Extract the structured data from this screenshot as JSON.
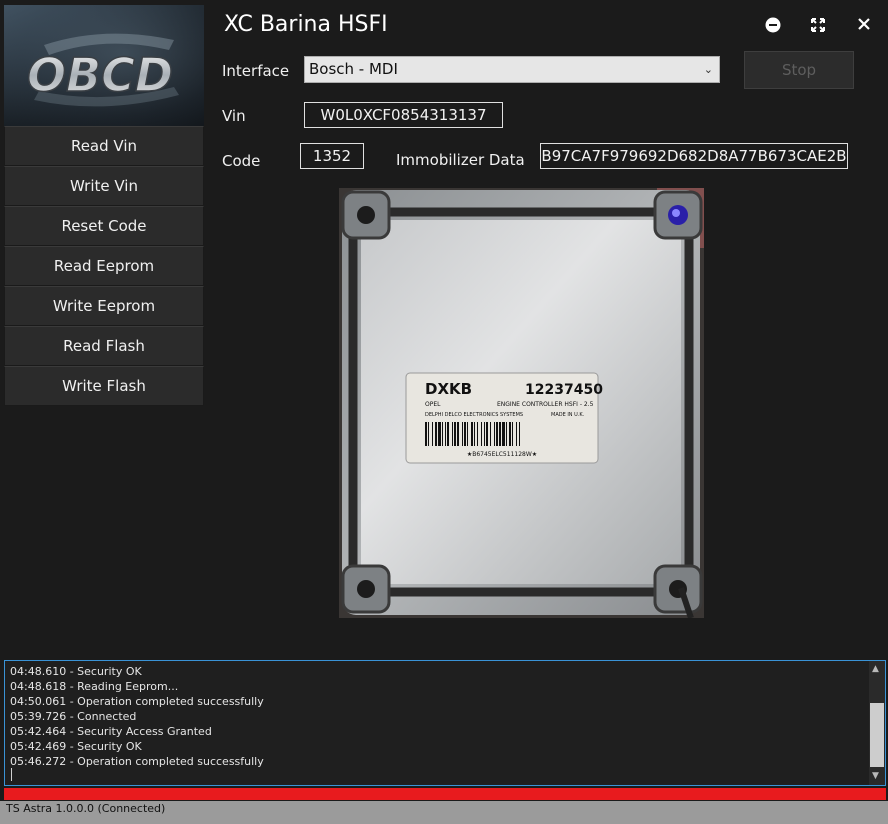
{
  "window": {
    "title": "XC Barina HSFI",
    "controls": {
      "minimize": "minimize",
      "maximize": "maximize",
      "close": "close"
    }
  },
  "logo": {
    "text": "OBCD"
  },
  "sidebar": {
    "items": [
      {
        "label": "Read Vin"
      },
      {
        "label": "Write Vin"
      },
      {
        "label": "Reset Code"
      },
      {
        "label": "Read Eeprom"
      },
      {
        "label": "Write Eeprom"
      },
      {
        "label": "Read Flash"
      },
      {
        "label": "Write Flash"
      }
    ]
  },
  "form": {
    "interface_label": "Interface",
    "interface_value": "Bosch - MDI",
    "stop_label": "Stop",
    "vin_label": "Vin",
    "vin_value": "W0L0XCF0854313137",
    "code_label": "Code",
    "code_value": "1352",
    "immo_label": "Immobilizer Data",
    "immo_value": "B97CA7F979692D682D8A77B673CAE2B"
  },
  "ecu_photo": {
    "label_code": "DXKB",
    "label_number": "12237450",
    "label_make": "OPEL",
    "label_desc": "ENGINE CONTROLLER HSFI - 2.5",
    "label_mfr": "DELPHI DELCO ELECTRONICS SYSTEMS",
    "label_origin": "MADE IN U.K.",
    "label_serial": "★B6745ELC511128W★"
  },
  "log": {
    "lines": [
      "04:48.610 - Security OK",
      "04:48.618 - Reading Eeprom...",
      "04:50.061 - Operation completed successfully",
      "05:39.726 - Connected",
      "05:42.464 - Security Access Granted",
      "05:42.469 - Security OK",
      "05:46.272 - Operation completed successfully"
    ]
  },
  "progress": {
    "percent": 100,
    "color": "#e81b1e"
  },
  "status": {
    "text": "TS Astra 1.0.0.0 (Connected)"
  },
  "colors": {
    "accent_border": "#3a93d6",
    "background": "#1b1b1b"
  }
}
